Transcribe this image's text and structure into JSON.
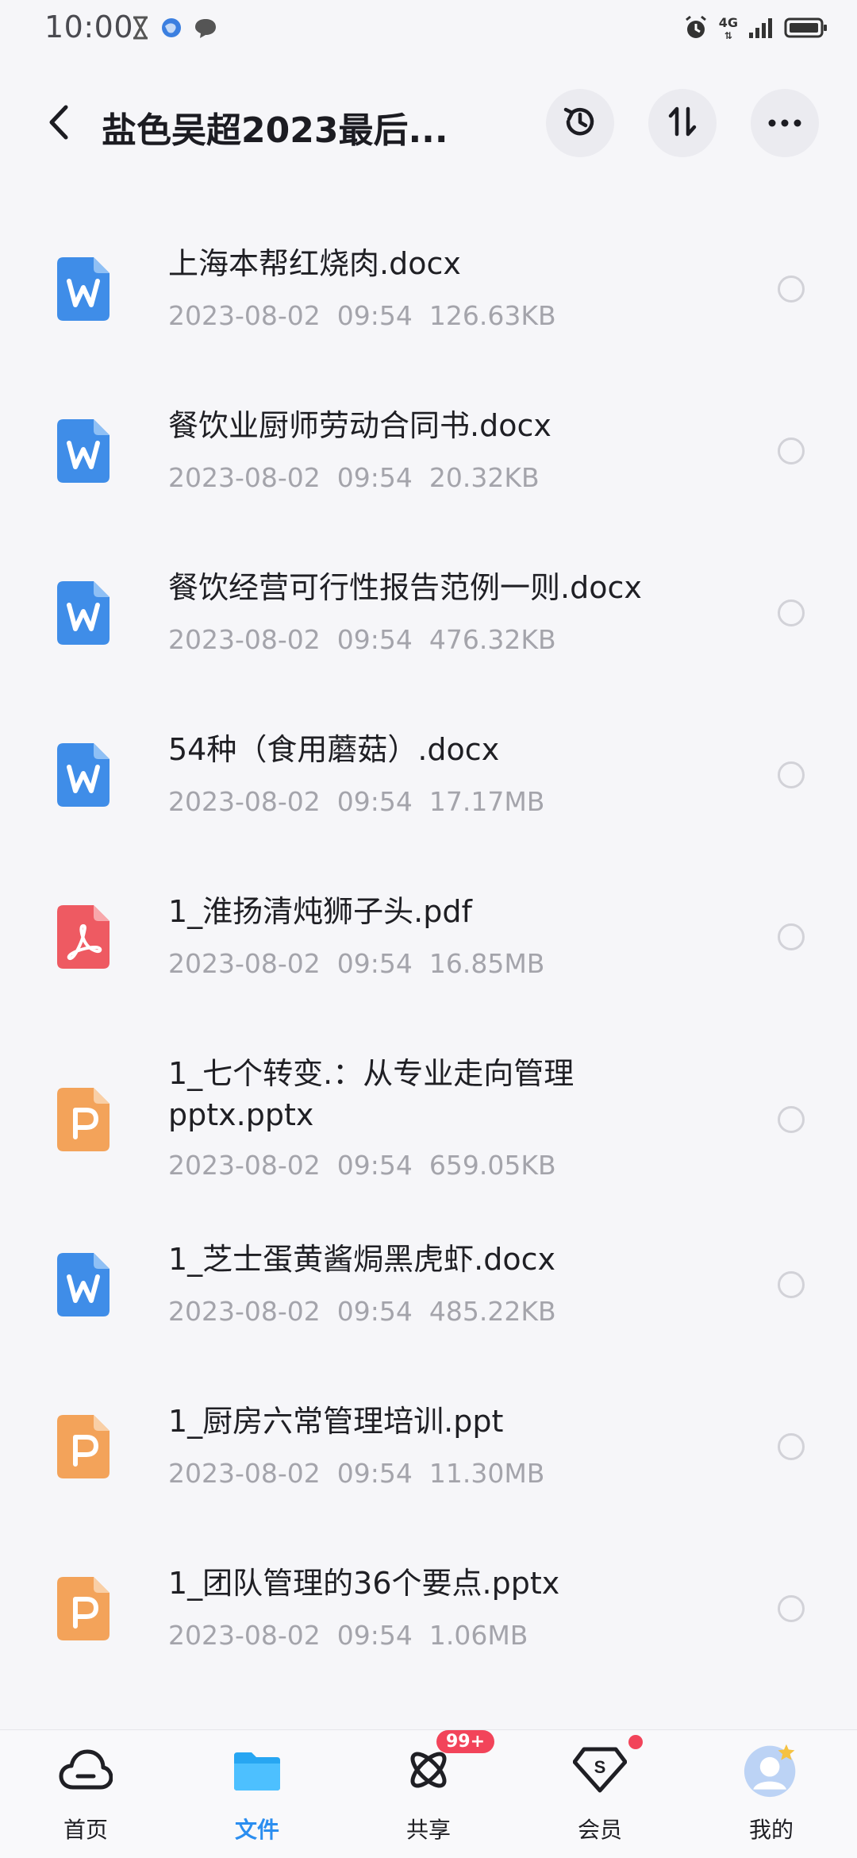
{
  "status_bar": {
    "time": "10:00",
    "network": "4G"
  },
  "header": {
    "title": "盐色吴超2023最后..."
  },
  "files": [
    {
      "name": "上海本帮红烧肉.docx",
      "date": "2023-08-02",
      "time": "09:54",
      "size": "126.63KB",
      "type": "word",
      "icon": "word-file-icon"
    },
    {
      "name": "餐饮业厨师劳动合同书.docx",
      "date": "2023-08-02",
      "time": "09:54",
      "size": "20.32KB",
      "type": "word",
      "icon": "word-file-icon"
    },
    {
      "name": "餐饮经营可行性报告范例一则.docx",
      "date": "2023-08-02",
      "time": "09:54",
      "size": "476.32KB",
      "type": "word",
      "icon": "word-file-icon"
    },
    {
      "name": "54种（食用蘑菇）.docx",
      "date": "2023-08-02",
      "time": "09:54",
      "size": "17.17MB",
      "type": "word",
      "icon": "word-file-icon"
    },
    {
      "name": "1_淮扬清炖狮子头.pdf",
      "date": "2023-08-02",
      "time": "09:54",
      "size": "16.85MB",
      "type": "pdf",
      "icon": "pdf-file-icon"
    },
    {
      "name": "1_七个转变.：从专业走向管理pptx.pptx",
      "date": "2023-08-02",
      "time": "09:54",
      "size": "659.05KB",
      "type": "ppt",
      "icon": "ppt-file-icon"
    },
    {
      "name": "1_芝士蛋黄酱焗黑虎虾.docx",
      "date": "2023-08-02",
      "time": "09:54",
      "size": "485.22KB",
      "type": "word",
      "icon": "word-file-icon"
    },
    {
      "name": "1_厨房六常管理培训.ppt",
      "date": "2023-08-02",
      "time": "09:54",
      "size": "11.30MB",
      "type": "ppt",
      "icon": "ppt-file-icon"
    },
    {
      "name": "1_团队管理的36个要点.pptx",
      "date": "2023-08-02",
      "time": "09:54",
      "size": "1.06MB",
      "type": "ppt",
      "icon": "ppt-file-icon"
    }
  ],
  "nav": {
    "items": [
      {
        "label": "首页",
        "icon": "cloud-home-icon"
      },
      {
        "label": "文件",
        "icon": "folder-icon"
      },
      {
        "label": "共享",
        "icon": "share-orbit-icon",
        "badge": "99+"
      },
      {
        "label": "会员",
        "icon": "vip-diamond-icon"
      },
      {
        "label": "我的",
        "icon": "avatar-icon"
      }
    ],
    "active": "文件"
  },
  "colors": {
    "background": "#f6f6f9",
    "accent": "#2b8ef0",
    "word_icon": "#3f8de8",
    "pdf_icon": "#ee5a62",
    "ppt_icon": "#f3a35a",
    "meta_text": "#a4a4ab",
    "badge": "#f2445a"
  }
}
